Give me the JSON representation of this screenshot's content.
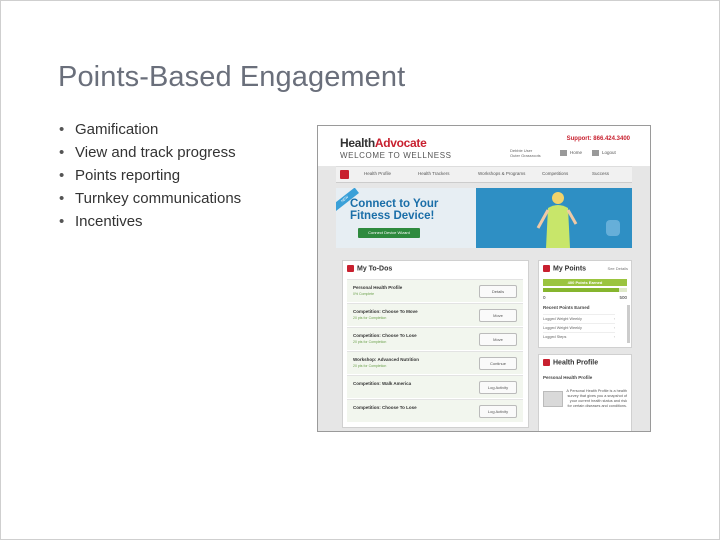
{
  "slide": {
    "title": "Points-Based Engagement",
    "bullets": [
      "Gamification",
      "View and track progress",
      "Points reporting",
      "Turnkey communications",
      "Incentives"
    ]
  },
  "screenshot": {
    "header": {
      "logo_health": "Health",
      "logo_advocate": "Advocate",
      "logo_sub": "WELCOME TO WELLNESS",
      "support": "Support: 866.424.3400",
      "welcome_line1": "Debbie User",
      "welcome_line2": "Outer Grassroots",
      "nav": [
        "Home",
        "Logout"
      ]
    },
    "navbar": {
      "items": [
        "Health Profile",
        "Health Trackers",
        "Workshops & Programs",
        "Competitions",
        "Success"
      ]
    },
    "banner": {
      "ribbon": "NEW",
      "title_line1": "Connect to Your",
      "title_line2": "Fitness Device!",
      "button": "Connect Device Wizard"
    },
    "todos": {
      "heading": "My To-Dos",
      "rows": [
        {
          "title": "Personal Health Profile",
          "sub": "0% Complete",
          "button": "Details"
        },
        {
          "title": "Competition: Choose To Move",
          "sub": "20 pts for Completion",
          "button": "Move"
        },
        {
          "title": "Competition: Choose To Lose",
          "sub": "20 pts for Completion",
          "button": "Move"
        },
        {
          "title": "Workshop: Advanced Nutrition",
          "sub": "20 pts for Completion",
          "button": "Continue"
        },
        {
          "title": "Competition: Walk America",
          "sub": "",
          "button": "Log Activity"
        },
        {
          "title": "Competition: Choose To Lose",
          "sub": "",
          "button": "Log Activity"
        }
      ]
    },
    "points": {
      "heading": "My Points",
      "see_all": "See Details",
      "earned": "400 Points Earned",
      "progress_fraction": 0.9,
      "min": "0",
      "max": "500",
      "recent_heading": "Recent Points Earned",
      "recent": [
        "Logged Weight Weekly",
        "Logged Weight Weekly",
        "Logged Steps"
      ]
    },
    "profile": {
      "heading": "Health Profile",
      "sub": "Personal Health Profile",
      "text": "A Personal Health Profile is a health survey that gives you a snapshot of your current health status and risk for certain diseases and conditions."
    },
    "colors": {
      "brand_red": "#c8202f",
      "banner_blue": "#2e8fc4",
      "points_green": "#9bc43f"
    }
  }
}
